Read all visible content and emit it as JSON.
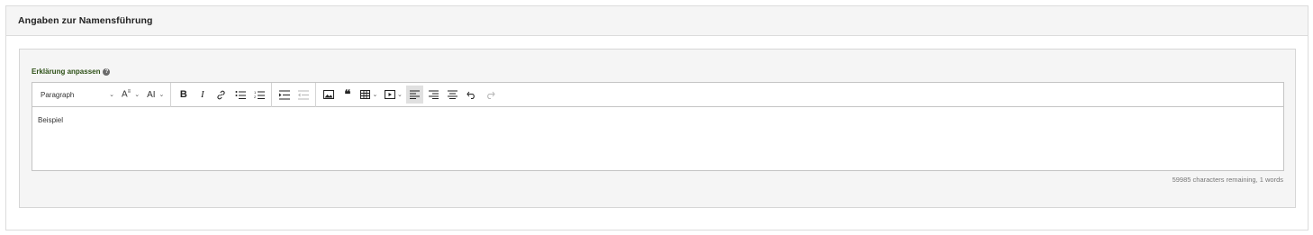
{
  "panel": {
    "title": "Angaben zur Namensführung"
  },
  "field": {
    "label": "Erklärung anpassen",
    "help_icon": "question-circle-icon"
  },
  "toolbar": {
    "paragraph_label": "Paragraph",
    "items": [
      "paragraph-dropdown",
      "font-size-icon",
      "text-size-icon",
      "bold-icon",
      "italic-icon",
      "link-icon",
      "bulleted-list-icon",
      "numbered-list-icon",
      "indent-icon",
      "outdent-icon",
      "image-icon",
      "blockquote-icon",
      "table-icon",
      "media-embed-icon",
      "align-left-icon",
      "align-right-icon",
      "align-center-icon",
      "undo-icon",
      "redo-icon"
    ]
  },
  "editor": {
    "content": "Beispiel"
  },
  "footer": {
    "counter": "59985 characters remaining, 1 words"
  },
  "colors": {
    "label_green": "#2d5016",
    "header_bg": "#f5f5f5",
    "border": "#dcdcdc"
  }
}
